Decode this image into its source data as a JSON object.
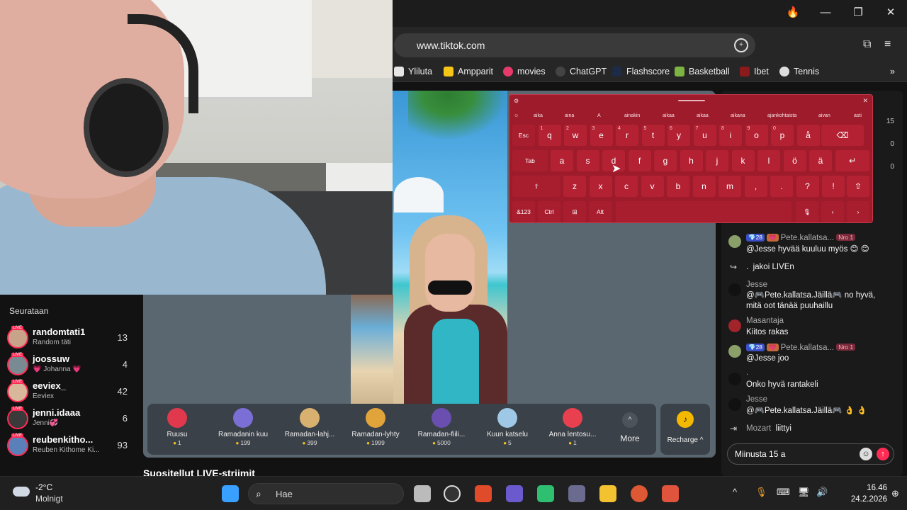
{
  "browser": {
    "url": "www.tiktok.com",
    "bookmarks": [
      {
        "label": "Yliluta",
        "icon": "yliluta-icon",
        "color": "#e6e6e6"
      },
      {
        "label": "Ampparit",
        "icon": "ampparit-icon",
        "color": "#f5c518"
      },
      {
        "label": "movies",
        "icon": "heart-icon",
        "color": "#e63b6a"
      },
      {
        "label": "ChatGPT",
        "icon": "chatgpt-icon",
        "color": "#444444"
      },
      {
        "label": "Flashscore",
        "icon": "flashscore-icon",
        "color": "#1d2b46"
      },
      {
        "label": "Basketball",
        "icon": "basketball-icon",
        "color": "#7cb342"
      },
      {
        "label": "Ibet",
        "icon": "ibet-icon",
        "color": "#8b1a1a"
      },
      {
        "label": "Tennis",
        "icon": "tennis-icon",
        "color": "#dddddd"
      }
    ]
  },
  "following": {
    "header": "Seurataan",
    "items": [
      {
        "name": "randomtati1",
        "sub": "Random täti",
        "count": "13"
      },
      {
        "name": "joossuw",
        "sub": "💗 Johanna 💗",
        "count": "4"
      },
      {
        "name": "eeviex_",
        "sub": "Eeviex",
        "count": "42"
      },
      {
        "name": "jenni.idaaa",
        "sub": "Jenni💞",
        "count": "6"
      },
      {
        "name": "reubenkitho...",
        "sub": "Reuben Kithome Ki...",
        "count": "93"
      }
    ],
    "live_badge": "LIVE"
  },
  "gifts": [
    {
      "name": "Ruusu",
      "price": "1",
      "color": "#e0384d"
    },
    {
      "name": "Ramadanin kuu",
      "price": "199",
      "color": "#7b6fd6"
    },
    {
      "name": "Ramadan-lahj...",
      "price": "399",
      "color": "#d8b070"
    },
    {
      "name": "Ramadan-lyhty",
      "price": "1999",
      "color": "#e0a43a"
    },
    {
      "name": "Ramadan-fiili...",
      "price": "5000",
      "color": "#6a4fb0"
    },
    {
      "name": "Kuun katselu",
      "price": "5",
      "color": "#9fc7e6"
    },
    {
      "name": "Anna lentosu...",
      "price": "1",
      "color": "#e8404f"
    }
  ],
  "more_label": "More",
  "recharge_label": "Recharge ^",
  "recommended_title": "Suositellut LIVE-striimit",
  "chat": {
    "top_numbers": [
      "15",
      "0",
      "0"
    ],
    "messages": [
      {
        "user": "Pete.kallatsa...",
        "badges": [
          "💎28",
          "💗",
          "Nro 1"
        ],
        "text": "@Jesse hyvää kuuluu myös 😊 😊"
      },
      {
        "user": ".",
        "text": "jakoi LIVEn",
        "share": true
      },
      {
        "user": "Jesse",
        "text": "@🎮Pete.kallatsa.Jäillä🎮 no hyvä, mitä oot tänää puuhaillu"
      },
      {
        "user": "Masantaja",
        "text": "Kiitos rakas"
      },
      {
        "user": "Pete.kallatsa...",
        "badges": [
          "💎28",
          "💗",
          "Nro 1"
        ],
        "text": "@Jesse joo"
      },
      {
        "user": ".",
        "text": "Onko hyvä rantakeli"
      },
      {
        "user": "Jesse",
        "text": "@🎮Pete.kallatsa.Jäillä🎮 👌 👌"
      },
      {
        "user": "Mozart",
        "text": "liittyi"
      }
    ],
    "input_value": "Miinusta 15 a"
  },
  "keyboard": {
    "suggestions": [
      "aika",
      "aina",
      "A",
      "ainakin",
      "aikaa",
      "aikaa",
      "aikana",
      "ajankohtaista",
      "aivan",
      "asti"
    ],
    "row1": [
      [
        "Esc",
        ""
      ],
      [
        "q",
        "1"
      ],
      [
        "w",
        "2"
      ],
      [
        "e",
        "3"
      ],
      [
        "r",
        "4"
      ],
      [
        "t",
        "5"
      ],
      [
        "y",
        "6"
      ],
      [
        "u",
        "7"
      ],
      [
        "i",
        "8"
      ],
      [
        "o",
        "9"
      ],
      [
        "p",
        "0"
      ],
      [
        "å",
        ""
      ],
      [
        "⌫",
        ""
      ]
    ],
    "row2": [
      "Tab",
      "a",
      "s",
      "d",
      "f",
      "g",
      "h",
      "j",
      "k",
      "l",
      "ö",
      "ä",
      "↵"
    ],
    "row3": [
      "⇧",
      "z",
      "x",
      "c",
      "v",
      "b",
      "n",
      "m",
      ",",
      ".",
      "?",
      "!",
      "⇧"
    ],
    "row4": [
      "&123",
      "Ctrl",
      "⊞",
      "Alt",
      "",
      "🎙",
      "‹",
      "›"
    ]
  },
  "taskbar": {
    "temperature": "-2°C",
    "weather": "Molnigt",
    "search_placeholder": "Hae",
    "time": "16.46",
    "date": "24.2.2026",
    "apps": [
      {
        "name": "windows-start-icon",
        "color": "#3aa0ff"
      },
      {
        "name": "file-copy-icon",
        "color": "#bbbbbb"
      },
      {
        "name": "obs-icon",
        "color": "#333333"
      },
      {
        "name": "office-icon",
        "color": "#e04b2a"
      },
      {
        "name": "camera-icon",
        "color": "#6a5acd"
      },
      {
        "name": "stats-icon",
        "color": "#2fbf71"
      },
      {
        "name": "calculator-icon",
        "color": "#6b6b8f"
      },
      {
        "name": "file-explorer-icon",
        "color": "#f2c230"
      },
      {
        "name": "duckduckgo-icon",
        "color": "#de5833"
      },
      {
        "name": "snip-icon",
        "color": "#e0533c"
      }
    ]
  }
}
